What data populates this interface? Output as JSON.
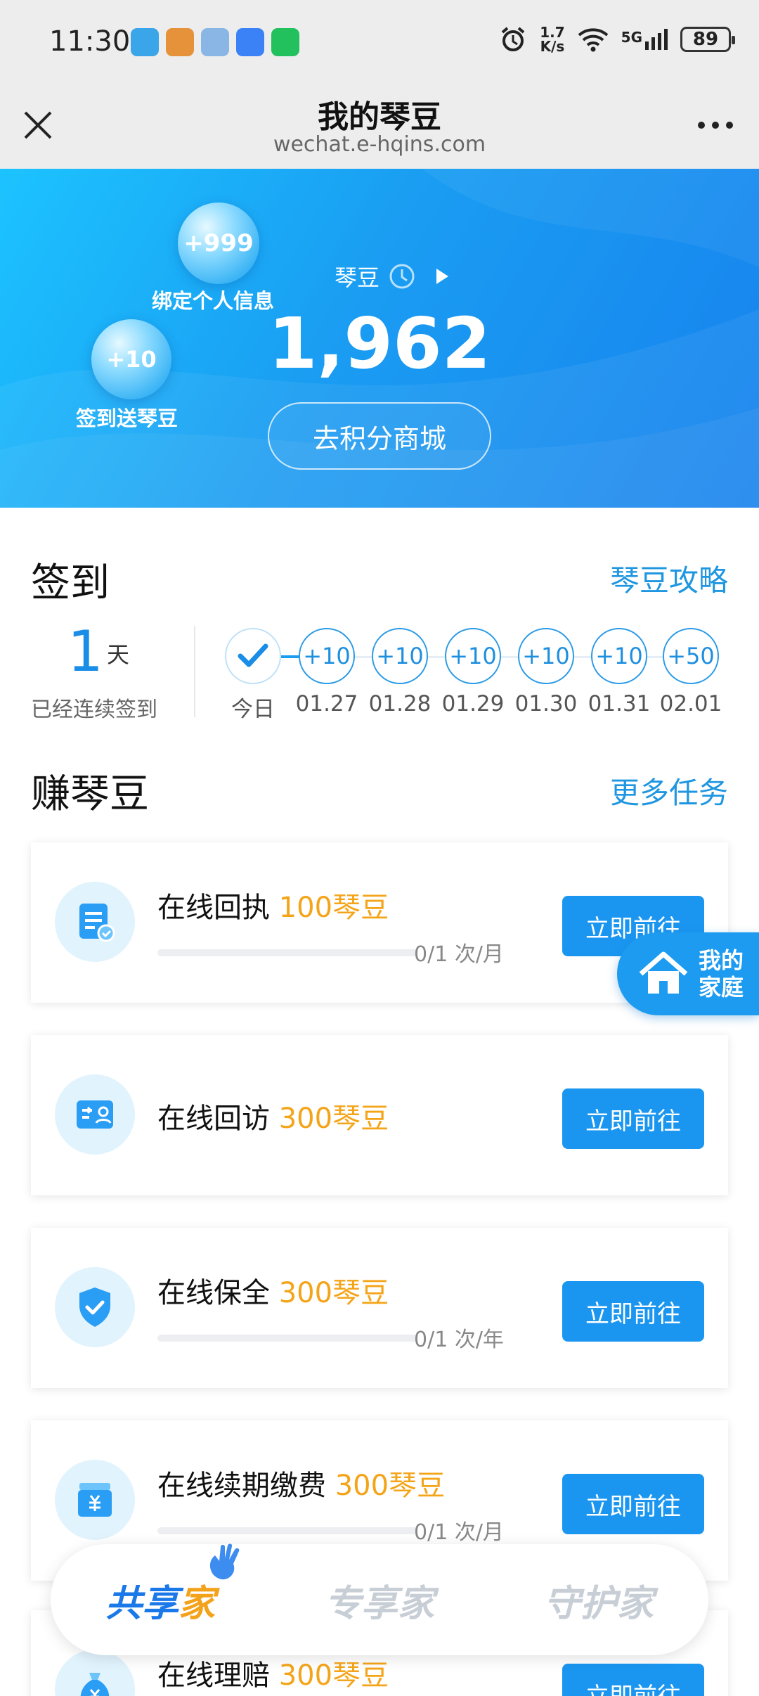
{
  "status_bar": {
    "time": "11:30",
    "speed_top": "1.7",
    "speed_bottom": "K/s",
    "network": "5G",
    "battery": "89",
    "app_icons": [
      "app-icon-1",
      "app-icon-2",
      "app-icon-3",
      "message-icon",
      "wechat-icon"
    ]
  },
  "title_bar": {
    "title": "我的琴豆",
    "subtitle": "wechat.e-hqins.com"
  },
  "hero": {
    "bubble_bind_value": "+999",
    "bubble_bind_label": "绑定个人信息",
    "bubble_sign_value": "+10",
    "bubble_sign_label": "签到送琴豆",
    "beans_label": "琴豆",
    "beans_value": "1,962",
    "mall_button": "去积分商城"
  },
  "sign_in": {
    "title": "签到",
    "link": "琴豆攻略",
    "streak_days": "1",
    "streak_unit": "天",
    "streak_label": "已经连续签到",
    "days": [
      {
        "reward": "",
        "label": "今日",
        "checked": true
      },
      {
        "reward": "+10",
        "label": "01.27"
      },
      {
        "reward": "+10",
        "label": "01.28"
      },
      {
        "reward": "+10",
        "label": "01.29"
      },
      {
        "reward": "+10",
        "label": "01.30"
      },
      {
        "reward": "+10",
        "label": "01.31"
      },
      {
        "reward": "+50",
        "label": "02.01"
      }
    ]
  },
  "earn": {
    "title": "赚琴豆",
    "link": "更多任务",
    "tasks": [
      {
        "name": "在线回执",
        "reward": "100琴豆",
        "progress": "0/1 次/月",
        "button": "立即前往",
        "icon": "document-check-icon"
      },
      {
        "name": "在线回访",
        "reward": "300琴豆",
        "progress": "",
        "button": "立即前往",
        "icon": "visit-card-icon"
      },
      {
        "name": "在线保全",
        "reward": "300琴豆",
        "progress": "0/1 次/年",
        "button": "立即前往",
        "icon": "shield-check-icon"
      },
      {
        "name": "在线续期缴费",
        "reward": "300琴豆",
        "progress": "0/1 次/月",
        "button": "立即前往",
        "icon": "payment-yuan-icon"
      },
      {
        "name": "在线理赔",
        "reward": "300琴豆",
        "progress": "",
        "button": "立即前往",
        "icon": "money-bag-icon"
      }
    ]
  },
  "floating_home": {
    "line1": "我的",
    "line2": "家庭"
  },
  "bottom_tabs": [
    {
      "part1": "共享",
      "part2": "家",
      "active": true
    },
    {
      "part1": "专享家",
      "part2": "",
      "active": false
    },
    {
      "part1": "守护家",
      "part2": "",
      "active": false
    }
  ],
  "colors": {
    "accent": "#1a96f0",
    "reward": "#f4a418",
    "hero_start": "#1cc3ff",
    "hero_end": "#1782ee"
  }
}
